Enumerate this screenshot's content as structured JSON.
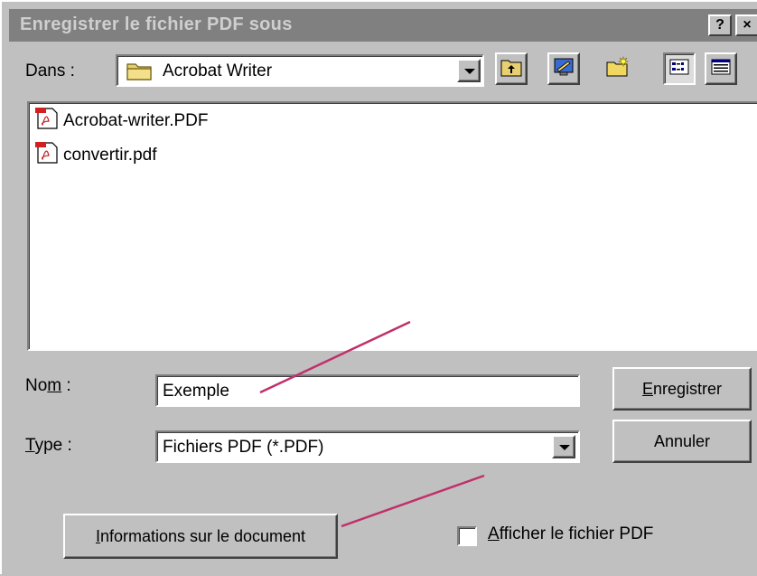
{
  "window": {
    "title": "Enregistrer le fichier PDF sous",
    "help_label": "?",
    "close_label": "×"
  },
  "location": {
    "label_pre": "Dans",
    "label_post": " :",
    "folder": "Acrobat Writer"
  },
  "toolbar": {
    "icons": [
      "up-folder-icon",
      "desktop-icon",
      "new-folder-icon",
      "list-view-icon",
      "details-view-icon"
    ]
  },
  "files": [
    {
      "name": "Acrobat-writer.PDF",
      "icon": "pdf-file-icon"
    },
    {
      "name": "convertir.pdf",
      "icon": "pdf-file-icon"
    }
  ],
  "filename": {
    "label_pre": "No",
    "label_u": "m",
    "label_post": " :",
    "value": "Exemple"
  },
  "filetype": {
    "label_u": "T",
    "label_post": "ype :",
    "value": "Fichiers PDF (*.PDF)"
  },
  "buttons": {
    "save_u": "E",
    "save_rest": "nregistrer",
    "cancel": "Annuler",
    "doc_info_u": "I",
    "doc_info_rest": "nformations sur le document"
  },
  "show_pdf": {
    "label_u": "A",
    "label_rest": "fficher le fichier PDF",
    "checked": false
  },
  "colors": {
    "titlebar": "#808080",
    "face": "#c0c0c0",
    "annotation_line": "#c0306a"
  }
}
